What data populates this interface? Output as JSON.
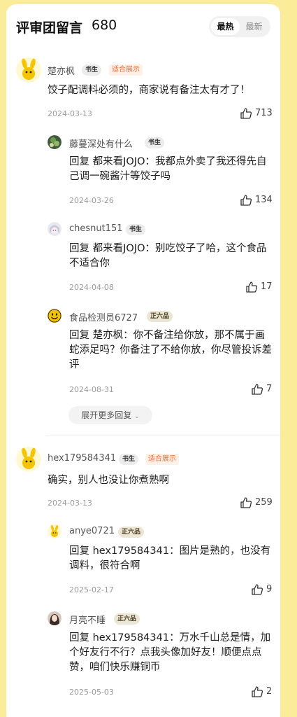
{
  "header": {
    "title": "评审团留言",
    "count": "680",
    "sort_hot": "最热",
    "sort_new": "最新"
  },
  "comments": [
    {
      "user": "楚亦枫",
      "badge": "书生",
      "tag": "适合展示",
      "text": "饺子配调料必须的，商家说有备注太有才了！",
      "date": "2024-03-13",
      "likes": "713",
      "avatar_icon": "yellow-bunny-icon",
      "replies": [
        {
          "user": "藤蔓深处有什么",
          "badge": "书生",
          "reply_to": "回复  都来看JOJO：",
          "text": "我都点外卖了我还得先自己调一碗酱汁等饺子吗",
          "date": "2024-03-26",
          "likes": "134",
          "avatar_icon": "green-leaf-avatar-icon"
        },
        {
          "user": "chesnut151",
          "badge": "书生",
          "reply_to": "回复  都来看JOJO：",
          "text": "别吃饺子了哈，这个食品不适合你",
          "date": "2024-04-08",
          "likes": "17",
          "avatar_icon": "anime-girl-avatar-icon"
        },
        {
          "user": "食品检测员6727",
          "badge": "正六品",
          "reply_to": "回复  楚亦枫：",
          "text": "你不备注给你放，那不属于画蛇添足吗？你备注了不给你放，你尽管投诉差评",
          "date": "2024-08-31",
          "likes": "7",
          "avatar_icon": "smiley-face-icon"
        }
      ],
      "more_replies": "展开更多回复"
    },
    {
      "user": "hex179584341",
      "badge": "书生",
      "tag": "适合展示",
      "text": "确实，别人也没让你煮熟啊",
      "date": "2024-03-13",
      "likes": "259",
      "avatar_icon": "yellow-bunny-icon",
      "replies": [
        {
          "user": "anye0721",
          "badge": "正六品",
          "reply_to": "回复  hex179584341：",
          "text": "图片是熟的，也没有调料，很符合啊",
          "date": "2025-02-17",
          "likes": "9",
          "avatar_icon": "yellow-bunny-icon"
        },
        {
          "user": "月亮不睡",
          "badge": "正六品",
          "reply_to": "回复  hex179584341：",
          "text": "万水千山总是情，加个好友行不行？点我头像加好友！顺便点点赞，咱们快乐赚铜币",
          "date": "2025-05-03",
          "likes": "2",
          "avatar_icon": "portrait-avatar-icon"
        }
      ]
    }
  ]
}
